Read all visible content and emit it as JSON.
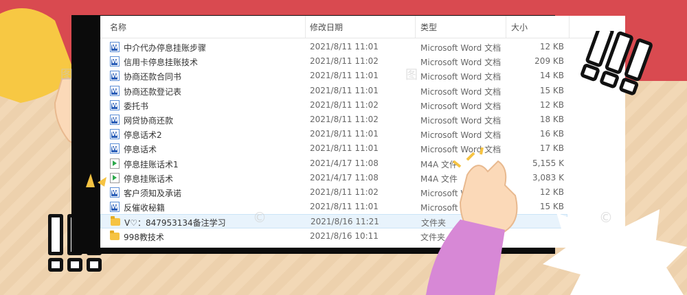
{
  "columns": {
    "name": "名称",
    "date": "修改日期",
    "type": "类型",
    "size": "大小"
  },
  "rows": [
    {
      "name": "中介代办停息挂账步骤",
      "date": "2021/8/11 11:01",
      "type": "Microsoft Word 文档",
      "size": "12 KB",
      "icon": "word-doc-icon"
    },
    {
      "name": "信用卡停息挂账技术",
      "date": "2021/8/11 11:02",
      "type": "Microsoft Word 文档",
      "size": "209 KB",
      "icon": "word-doc-icon"
    },
    {
      "name": "协商还款合同书",
      "date": "2021/8/11 11:01",
      "type": "Microsoft Word 文档",
      "size": "14 KB",
      "icon": "word-doc-icon"
    },
    {
      "name": "协商还款登记表",
      "date": "2021/8/11 11:01",
      "type": "Microsoft Word 文档",
      "size": "15 KB",
      "icon": "word-doc-icon"
    },
    {
      "name": "委托书",
      "date": "2021/8/11 11:02",
      "type": "Microsoft Word 文档",
      "size": "12 KB",
      "icon": "word-doc-icon"
    },
    {
      "name": "网贷协商还款",
      "date": "2021/8/11 11:02",
      "type": "Microsoft Word 文档",
      "size": "18 KB",
      "icon": "word-doc-icon"
    },
    {
      "name": "停息话术2",
      "date": "2021/8/11 11:01",
      "type": "Microsoft Word 文档",
      "size": "16 KB",
      "icon": "word-doc-icon"
    },
    {
      "name": "停息话术",
      "date": "2021/8/11 11:01",
      "type": "Microsoft Word 文档",
      "size": "17 KB",
      "icon": "word-doc-icon"
    },
    {
      "name": "停息挂账话术1",
      "date": "2021/4/17 11:08",
      "type": "M4A 文件",
      "size": "5,155 K",
      "icon": "audio-file-icon"
    },
    {
      "name": "停息挂账话术",
      "date": "2021/4/17 11:08",
      "type": "M4A 文件",
      "size": "3,083 K",
      "icon": "audio-file-icon"
    },
    {
      "name": "客户须知及承诺",
      "date": "2021/8/11 11:02",
      "type": "Microsoft Word 文档",
      "size": "12 KB",
      "icon": "word-doc-icon"
    },
    {
      "name": "反催收秘籍",
      "date": "2021/8/11 11:01",
      "type": "Microsoft Word 文档",
      "size": "15 KB",
      "icon": "word-doc-icon"
    },
    {
      "name": "V♡：847953134备注学习",
      "date": "2021/8/16 11:21",
      "type": "文件夹",
      "size": "",
      "icon": "folder-icon",
      "selected": true
    },
    {
      "name": "998教技术",
      "date": "2021/8/16 10:11",
      "type": "文件夹",
      "size": "",
      "icon": "folder-icon"
    }
  ],
  "colors": {
    "accent_red": "#d94a50",
    "beige": "#f2d8b6",
    "selection": "#e8f3fc"
  }
}
